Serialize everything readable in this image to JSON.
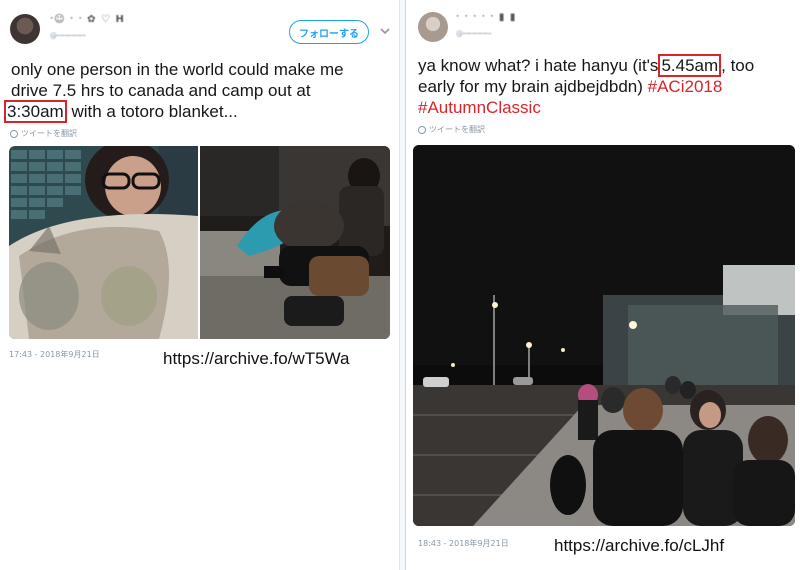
{
  "left_tweet": {
    "name": "ᐧ☺ ᐧ ᐧ ✿ ♡ H",
    "handle": "@ꟷꟷꟷꟷꟷ",
    "follow_label": "フォローする",
    "text_line1": "only one person in the world could make me",
    "text_line2": "drive 7.5 hrs to canada and camp out at",
    "text_line3_highlight": "3:30am",
    "text_line3_rest": "with a totoro blanket...",
    "translate_label": "ツイートを翻訳",
    "timestamp": "17:43 - 2018年9月21日",
    "archive_url": "https://archive.fo/wT5Wa"
  },
  "right_tweet": {
    "name": "ᐧ ᐧ ᐧ ᐧ ᐧ ▮ ▮",
    "handle": "@ꟷꟷꟷꟷꟷ",
    "text_line1_pre": "ya know what? i hate hanyu (it's",
    "text_line1_highlight": "5.45am",
    "text_line1_post": ", too",
    "text_line2_pre": "early for my brain ajdbejdbdn)",
    "hashtag1": "#ACi2018",
    "hashtag2": "#AutumnClassic",
    "translate_label": "ツイートを翻訳",
    "timestamp": "18:43 - 2018年9月21日",
    "archive_url": "https://archive.fo/cLJhf"
  },
  "colors": {
    "highlight_box": "#d8252a",
    "hashtag": "#d8252a",
    "follow_accent": "#1da1f2"
  }
}
